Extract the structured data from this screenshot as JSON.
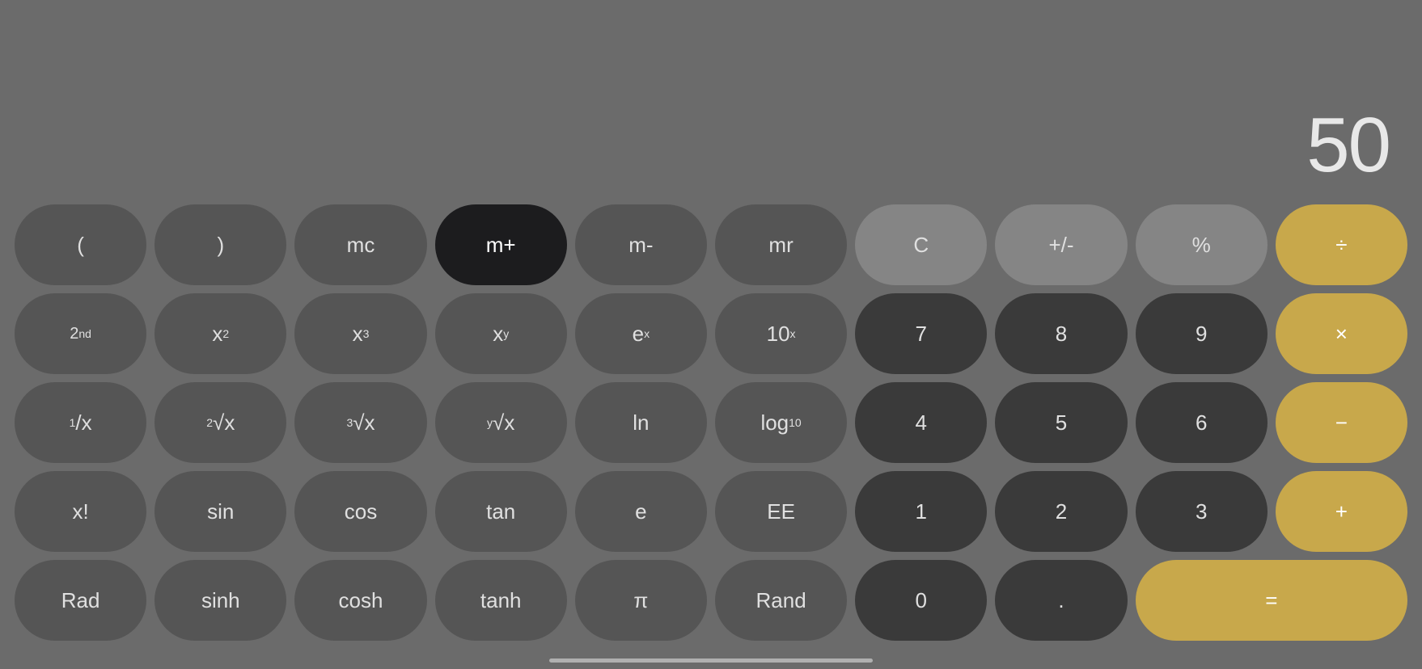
{
  "display": {
    "value": "50"
  },
  "colors": {
    "dark_button": "#555555",
    "darkest_button": "#3a3a3a",
    "black_button": "#1c1c1e",
    "medium_button": "#858585",
    "gold_button": "#c8a84b",
    "background": "#6b6b6b"
  },
  "rows": [
    [
      {
        "label": "(",
        "type": "dark",
        "name": "open-paren"
      },
      {
        "label": ")",
        "type": "dark",
        "name": "close-paren"
      },
      {
        "label": "mc",
        "type": "dark",
        "name": "mc"
      },
      {
        "label": "m+",
        "type": "black",
        "name": "m-plus"
      },
      {
        "label": "m-",
        "type": "dark",
        "name": "m-minus"
      },
      {
        "label": "mr",
        "type": "dark",
        "name": "mr"
      },
      {
        "label": "C",
        "type": "medium",
        "name": "clear"
      },
      {
        "label": "+/-",
        "type": "medium",
        "name": "plus-minus"
      },
      {
        "label": "%",
        "type": "medium",
        "name": "percent"
      },
      {
        "label": "÷",
        "type": "gold",
        "name": "divide"
      }
    ],
    [
      {
        "label": "2nd",
        "type": "dark",
        "name": "second"
      },
      {
        "label": "x²",
        "type": "dark",
        "name": "x-squared"
      },
      {
        "label": "x³",
        "type": "dark",
        "name": "x-cubed"
      },
      {
        "label": "xʸ",
        "type": "dark",
        "name": "x-to-y"
      },
      {
        "label": "eˣ",
        "type": "dark",
        "name": "e-to-x"
      },
      {
        "label": "10ˣ",
        "type": "dark",
        "name": "ten-to-x"
      },
      {
        "label": "7",
        "type": "darkest",
        "name": "seven"
      },
      {
        "label": "8",
        "type": "darkest",
        "name": "eight"
      },
      {
        "label": "9",
        "type": "darkest",
        "name": "nine"
      },
      {
        "label": "×",
        "type": "gold",
        "name": "multiply"
      }
    ],
    [
      {
        "label": "¹/x",
        "type": "dark",
        "name": "one-over-x"
      },
      {
        "label": "²√x",
        "type": "dark",
        "name": "square-root"
      },
      {
        "label": "³√x",
        "type": "dark",
        "name": "cube-root"
      },
      {
        "label": "ʸ√x",
        "type": "dark",
        "name": "y-root"
      },
      {
        "label": "ln",
        "type": "dark",
        "name": "ln"
      },
      {
        "label": "log₁₀",
        "type": "dark",
        "name": "log10"
      },
      {
        "label": "4",
        "type": "darkest",
        "name": "four"
      },
      {
        "label": "5",
        "type": "darkest",
        "name": "five"
      },
      {
        "label": "6",
        "type": "darkest",
        "name": "six"
      },
      {
        "label": "−",
        "type": "gold",
        "name": "subtract"
      }
    ],
    [
      {
        "label": "x!",
        "type": "dark",
        "name": "factorial"
      },
      {
        "label": "sin",
        "type": "dark",
        "name": "sin"
      },
      {
        "label": "cos",
        "type": "dark",
        "name": "cos"
      },
      {
        "label": "tan",
        "type": "dark",
        "name": "tan"
      },
      {
        "label": "e",
        "type": "dark",
        "name": "euler"
      },
      {
        "label": "EE",
        "type": "dark",
        "name": "ee"
      },
      {
        "label": "1",
        "type": "darkest",
        "name": "one"
      },
      {
        "label": "2",
        "type": "darkest",
        "name": "two"
      },
      {
        "label": "3",
        "type": "darkest",
        "name": "three"
      },
      {
        "label": "+",
        "type": "gold",
        "name": "add"
      }
    ],
    [
      {
        "label": "Rad",
        "type": "dark",
        "name": "rad"
      },
      {
        "label": "sinh",
        "type": "dark",
        "name": "sinh"
      },
      {
        "label": "cosh",
        "type": "dark",
        "name": "cosh"
      },
      {
        "label": "tanh",
        "type": "dark",
        "name": "tanh"
      },
      {
        "label": "π",
        "type": "dark",
        "name": "pi"
      },
      {
        "label": "Rand",
        "type": "dark",
        "name": "rand"
      },
      {
        "label": "0",
        "type": "darkest",
        "name": "zero"
      },
      {
        "label": ".",
        "type": "darkest",
        "name": "decimal"
      },
      {
        "label": "=",
        "type": "gold",
        "name": "equals",
        "span": 2
      }
    ]
  ],
  "home_indicator": {
    "visible": true
  }
}
